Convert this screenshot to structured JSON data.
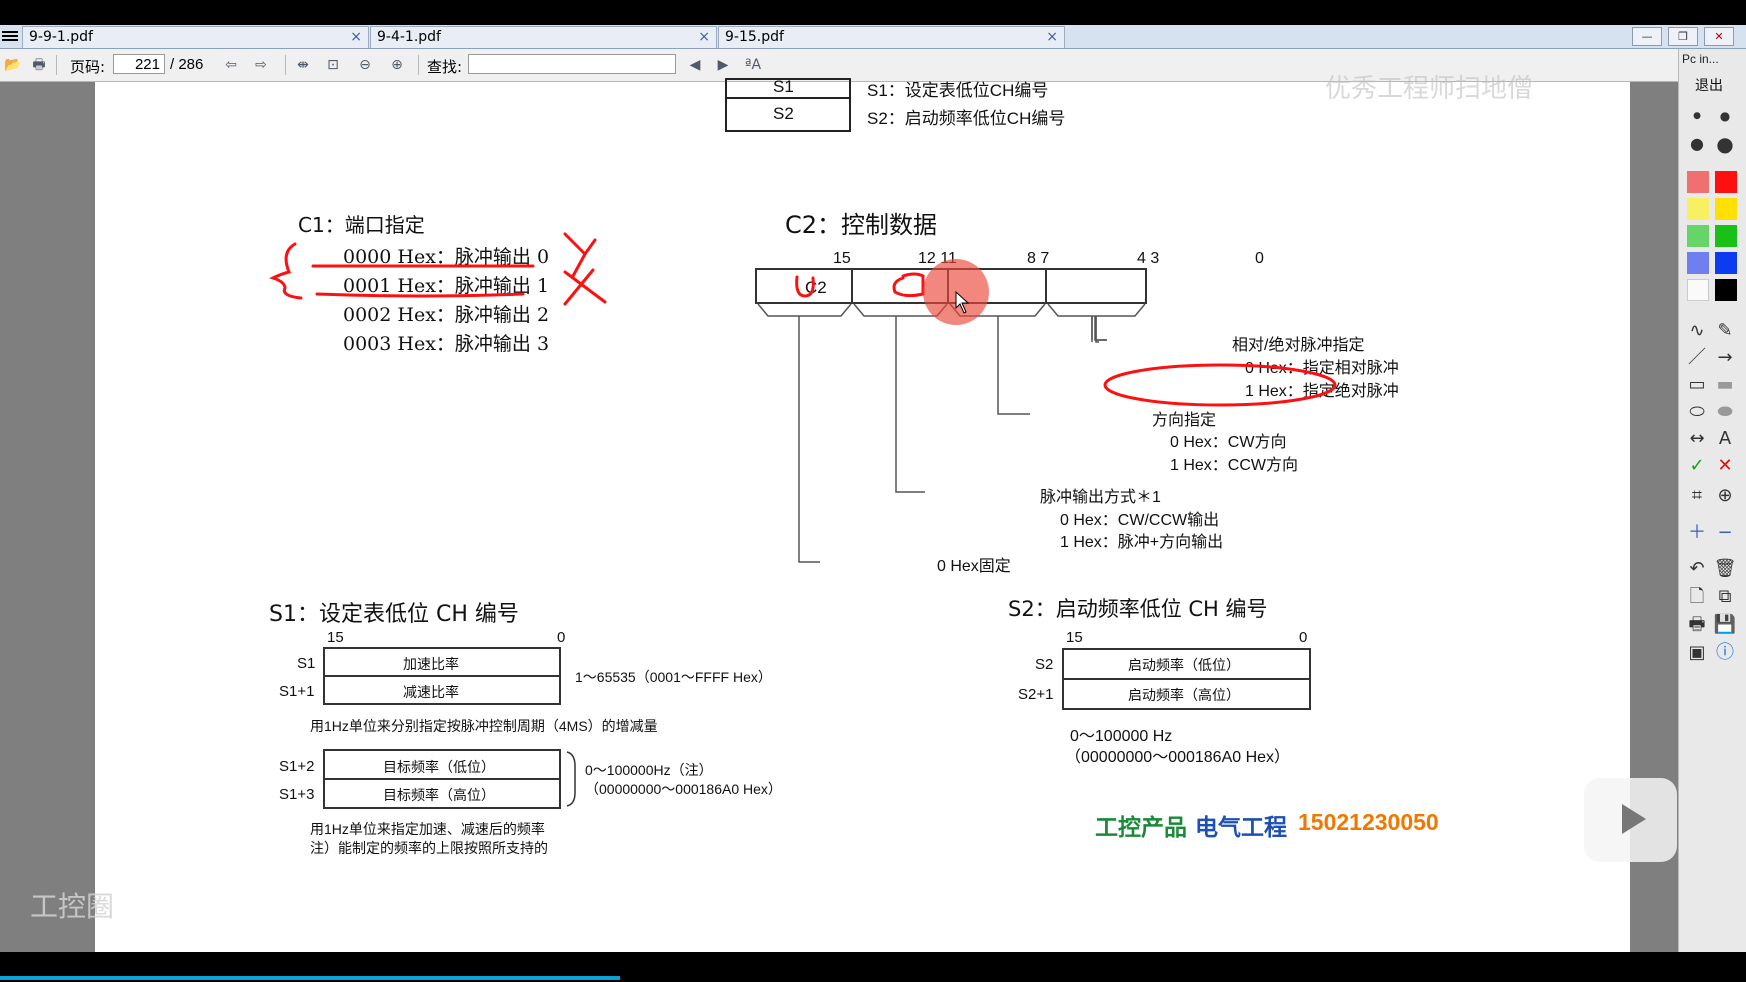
{
  "tabs": [
    {
      "label": "9-9-1.pdf",
      "close": "×"
    },
    {
      "label": "9-4-1.pdf",
      "close": "×"
    },
    {
      "label": "9-15.pdf",
      "close": "×"
    }
  ],
  "toolbar": {
    "page_label": "页码:",
    "page_current": "221",
    "page_total": "/ 286",
    "find_label": "查找:",
    "find_value": ""
  },
  "palette": {
    "header": "Pc in...",
    "exit_label": "退出",
    "text_tool": "A"
  },
  "doc": {
    "top_table": [
      {
        "cell": "S1",
        "desc": "S1：设定表低位CH编号"
      },
      {
        "cell": "S2",
        "desc": "S2：启动频率低位CH编号"
      }
    ],
    "c1": {
      "title": "C1：端口指定",
      "items": [
        "0000 Hex：脉冲输出 0",
        "0001 Hex：脉冲输出 1",
        "0002 Hex：脉冲输出 2",
        "0003 Hex：脉冲输出 3"
      ]
    },
    "c2": {
      "title": "C2：控制数据",
      "reg_label": "C2",
      "bits": [
        "15",
        "12 11",
        "8 7",
        "4 3",
        "0"
      ],
      "field1_title": "相对/绝对脉冲指定",
      "field1_opt0": "0 Hex：指定相对脉冲",
      "field1_opt1": "1 Hex：指定绝对脉冲",
      "field2_title": "方向指定",
      "field2_opt0": "0 Hex：CW方向",
      "field2_opt1": "1 Hex：CCW方向",
      "field3_title": "脉冲输出方式＊1",
      "field3_opt0": "0 Hex：CW/CCW输出",
      "field3_opt1": "1 Hex：脉冲+方向输出",
      "field4": "0 Hex固定"
    },
    "s1": {
      "title": "S1：设定表低位 CH 编号",
      "bit_hi": "15",
      "bit_lo": "0",
      "rows": [
        {
          "label": "S1",
          "cell": "加速比率"
        },
        {
          "label": "S1+1",
          "cell": "减速比率"
        },
        {
          "label": "S1+2",
          "cell": "目标频率（低位）"
        },
        {
          "label": "S1+3",
          "cell": "目标频率（高位）"
        }
      ],
      "range1": "1～65535（0001～FFFF Hex）",
      "note1": "用1Hz单位来分别指定按脉冲控制周期（4MS）的增减量",
      "range2a": "0～100000Hz（注）",
      "range2b": "（00000000～000186A0 Hex）",
      "note2a": "用1Hz单位来指定加速、减速后的频率",
      "note2b": "注）能制定的频率的上限按照所支持的"
    },
    "s2": {
      "title": "S2：启动频率低位 CH 编号",
      "bit_hi": "15",
      "bit_lo": "0",
      "rows": [
        {
          "label": "S2",
          "cell": "启动频率（低位）"
        },
        {
          "label": "S2+1",
          "cell": "启动频率（高位）"
        }
      ],
      "range1": "0～100000 Hz",
      "range2": "（00000000～000186A0 Hex）"
    },
    "watermark_top": "优秀工程师扫地僧",
    "footer_brand": "工控产品",
    "footer_brand2": "电气工程",
    "footer_phone": "15021230050",
    "bottom_left_mark": "工控圈"
  },
  "colors": {
    "annotation_red": "#ff1010",
    "footer_green": "#1a8a3a",
    "footer_blue": "#1d4fb5",
    "footer_orange": "#f07800",
    "tab_bg": "#d7e2f0",
    "progress": "#0aa1d9"
  }
}
